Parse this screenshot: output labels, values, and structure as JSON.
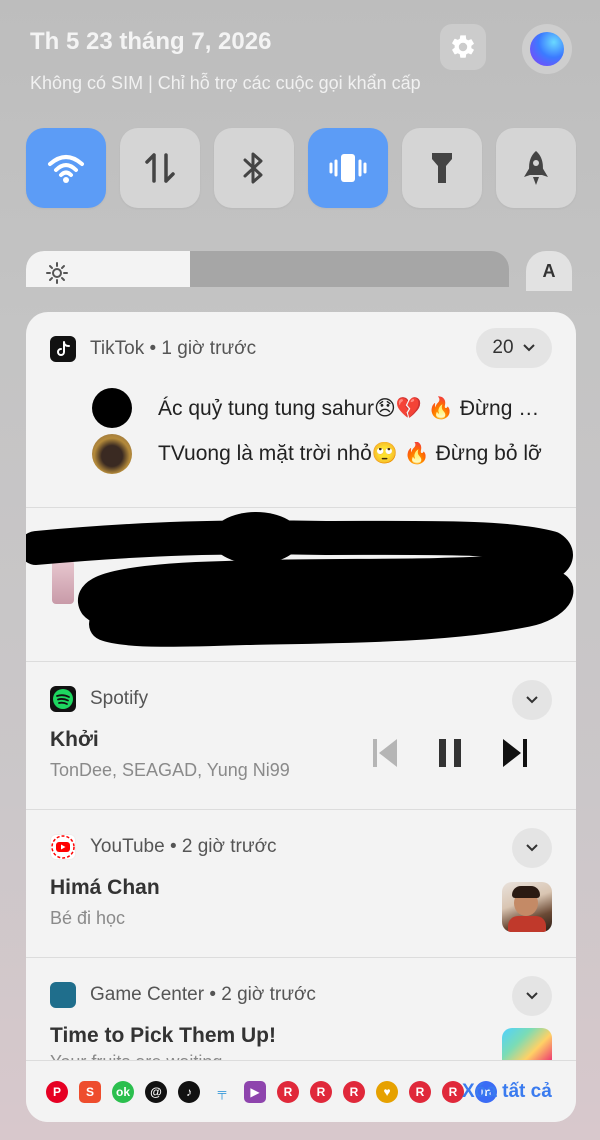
{
  "header": {
    "date": "Th 5 23 tháng 7, 2026",
    "sim_status": "Không có SIM | Chỉ hỗ trợ các cuộc gọi khẩn cấp"
  },
  "quick_tiles": [
    {
      "name": "wifi",
      "icon": "wifi-icon",
      "active": true
    },
    {
      "name": "mobile-data",
      "icon": "data-arrows-icon",
      "active": false
    },
    {
      "name": "bluetooth",
      "icon": "bluetooth-icon",
      "active": false
    },
    {
      "name": "vibrate",
      "icon": "vibrate-icon",
      "active": true
    },
    {
      "name": "flashlight",
      "icon": "flashlight-icon",
      "active": false
    },
    {
      "name": "rocket",
      "icon": "rocket-icon",
      "active": false
    }
  ],
  "brightness": {
    "level": 0.34,
    "auto_label": "A"
  },
  "notifications": {
    "tiktok": {
      "app": "TikTok",
      "time": "1 giờ trước",
      "count": "20",
      "items": [
        {
          "text": "Ác quỷ tung tung sahur😞💔 🔥  Đừng bỏ lỡ"
        },
        {
          "text": "TVuong là mặt trời nhỏ🙄 🔥  Đừng bỏ lỡ"
        }
      ]
    },
    "spotify": {
      "app": "Spotify",
      "track": "Khởi",
      "artists": "TonDee, SEAGAD, Yung Ni99"
    },
    "youtube": {
      "app": "YouTube",
      "time": "2 giờ trước",
      "title": "Himá Chan",
      "subtitle": "Bé đi học"
    },
    "game_center": {
      "app": "Game Center",
      "time": "2 giờ trước",
      "title": "Time to Pick Them Up!",
      "subtitle": "Your fruits are waiting"
    }
  },
  "footer": {
    "clear_all": "Xóa tất cả",
    "app_icons": [
      "pinterest-icon",
      "shopee-icon",
      "ok-icon",
      "threads-icon",
      "tiktok-icon",
      "pin-icon",
      "meet-icon",
      "r-icon",
      "r-icon",
      "r-icon",
      "heart-coin-icon",
      "r-icon",
      "r-icon",
      "messenger-icon",
      "r-icon",
      "r-icon"
    ]
  },
  "colors": {
    "accent": "#5c9cf6",
    "clear_all": "#3a7bef",
    "spotify": "#1ed760",
    "youtube": "#ff0000"
  }
}
